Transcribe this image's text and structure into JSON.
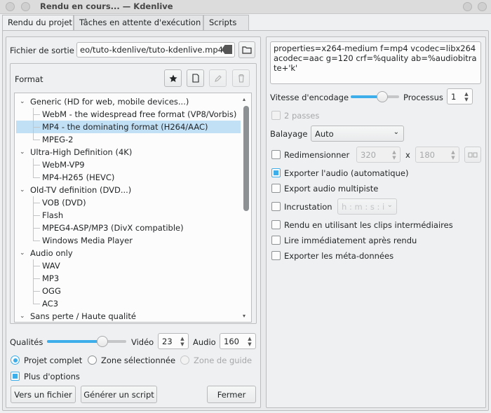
{
  "window": {
    "title": "Rendu en cours... — Kdenlive"
  },
  "tabs": [
    {
      "label": "Rendu du projet",
      "active": true
    },
    {
      "label": "Tâches en attente d'exécution",
      "active": false
    },
    {
      "label": "Scripts",
      "active": false
    }
  ],
  "output": {
    "label": "Fichier de sortie",
    "value": "eo/tuto-kdenlive/tuto-kdenlive.mp4"
  },
  "format": {
    "label": "Format",
    "groups": [
      {
        "name": "Generic (HD for web, mobile devices...)",
        "items": [
          "WebM - the widespread free format (VP8/Vorbis)",
          "MP4 - the dominating format (H264/AAC)",
          "MPEG-2"
        ]
      },
      {
        "name": "Ultra-High Definition (4K)",
        "items": [
          "WebM-VP9",
          "MP4-H265 (HEVC)"
        ]
      },
      {
        "name": "Old-TV definition (DVD...)",
        "items": [
          "VOB (DVD)",
          "Flash",
          "MPEG4-ASP/MP3 (DivX compatible)",
          "Windows Media Player"
        ]
      },
      {
        "name": "Audio only",
        "items": [
          "WAV",
          "MP3",
          "OGG",
          "AC3"
        ]
      },
      {
        "name": "Sans perte / Haute qualité",
        "items": []
      }
    ],
    "selected": "MP4 - the dominating format (H264/AAC)"
  },
  "quality": {
    "label": "Qualités",
    "slider_fraction": 0.7,
    "video_label": "Vidéo",
    "video_value": "23",
    "audio_label": "Audio",
    "audio_value": "160"
  },
  "scope": {
    "options": [
      {
        "label": "Projet complet",
        "checked": true,
        "enabled": true
      },
      {
        "label": "Zone sélectionnée",
        "checked": false,
        "enabled": true
      },
      {
        "label": "Zone de guide",
        "checked": false,
        "enabled": false
      }
    ]
  },
  "more_options": {
    "label": "Plus d'options",
    "checked": true
  },
  "buttons": {
    "to_file": "Vers un fichier",
    "generate_script": "Générer un script",
    "close": "Fermer"
  },
  "right": {
    "properties": "properties=x264-medium f=mp4 vcodec=libx264 acodec=aac g=120 crf=%quality ab=%audiobitrate+'k'",
    "speed_label": "Vitesse d'encodage",
    "speed_fraction": 0.65,
    "threads_label": "Processus",
    "threads_value": "1",
    "two_pass": "2 passes",
    "scanning_label": "Balayage",
    "scanning_value": "Auto",
    "resize_label": "Redimensionner",
    "resize_w": "320",
    "resize_x": "x",
    "resize_h": "180",
    "export_audio": "Exporter l'audio (automatique)",
    "export_multitrack": "Export audio multipiste",
    "overlay_label": "Incrustation",
    "overlay_value": "h : m : s : i",
    "proxy_clips": "Rendu en utilisant les clips intermédiaires",
    "play_after": "Lire immédiatement après rendu",
    "export_metadata": "Exporter les méta-données"
  }
}
